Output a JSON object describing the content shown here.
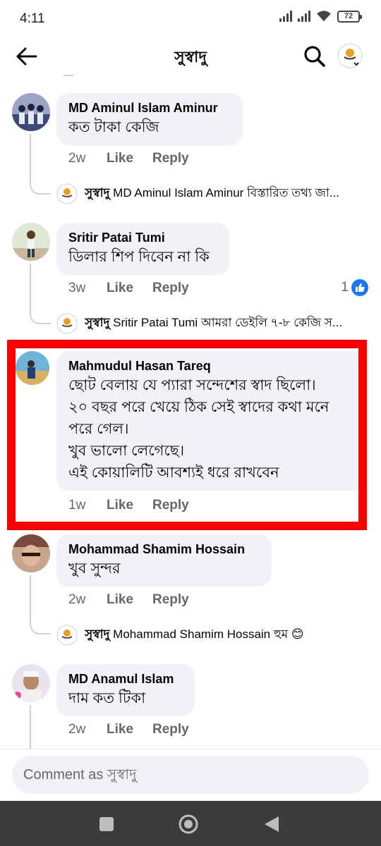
{
  "status_bar": {
    "time": "4:11",
    "battery": "72"
  },
  "header": {
    "title": "সুস্বাদু"
  },
  "comments": [
    {
      "author": "MD Aminul Islam Aminur",
      "text": "কত টাকা কেজি",
      "time": "2w",
      "like": "Like",
      "reply": "Reply",
      "page_reply": {
        "page": "সুস্বাদু",
        "text": "MD Aminul Islam Aminur বিস্তারিত তথ্য জা..."
      }
    },
    {
      "author": "Sritir Patai Tumi",
      "text": "ডিলার শিপ দিবেন না কি",
      "time": "3w",
      "like": "Like",
      "reply": "Reply",
      "reaction_count": "1",
      "page_reply": {
        "page": "সুস্বাদু",
        "text": "Sritir Patai Tumi আমরা ডেইলি ৭-৮ কেজি স..."
      }
    },
    {
      "author": "Mahmudul Hasan Tareq",
      "text": "ছোট বেলায় যে প্যারা সন্দেশের স্বাদ ছিলো।\n২০ বছর পরে খেয়ে ঠিক সেই স্বাদের কথা মনে পরে গেল।\nখুব ভালো লেগেছে।\nএই কোয়ালিটি আবশ্যই ধরে রাখবেন",
      "time": "1w",
      "like": "Like",
      "reply": "Reply"
    },
    {
      "author": "Mohammad Shamim Hossain",
      "text": "খুব সুন্দর",
      "time": "2w",
      "like": "Like",
      "reply": "Reply",
      "page_reply": {
        "page": "সুস্বাদু",
        "text": "Mohammad Shamim Hossain হুম 😊"
      }
    },
    {
      "author": "MD Anamul Islam",
      "text": "দাম কত টিকা",
      "time": "2w",
      "like": "Like",
      "reply": "Reply"
    }
  ],
  "composer": {
    "placeholder": "Comment as সুস্বাদু"
  },
  "colors": {
    "highlight": "#ff0000",
    "like_blue": "#1877f2",
    "bubble": "#f0f2f5",
    "secondary_text": "#65676b"
  },
  "icons": [
    "back-arrow-icon",
    "search-icon",
    "page-avatar-icon",
    "thumbs-up-icon",
    "nav-square-icon",
    "nav-circle-icon",
    "nav-back-icon"
  ]
}
